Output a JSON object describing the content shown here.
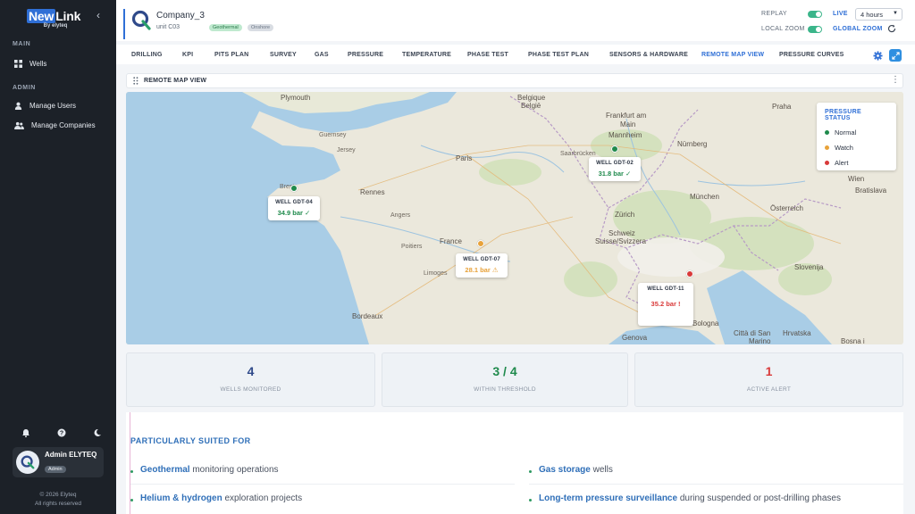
{
  "app": {
    "logo": {
      "new": "New",
      "link": "Link",
      "sub": "By elyteq"
    },
    "sidebar": {
      "main_section": "MAIN",
      "admin_section": "ADMIN",
      "items": [
        {
          "label": "Wells",
          "icon": "grid-icon"
        },
        {
          "label": "Manage Users",
          "icon": "user-icon"
        },
        {
          "label": "Manage Companies",
          "icon": "users-icon"
        }
      ],
      "bottom_icons": [
        "bell-icon",
        "help-icon",
        "moon-icon"
      ],
      "user": {
        "name": "Admin ELYTEQ",
        "role": "Admin"
      },
      "copyright": "© 2026 Elyteq",
      "rights": "All rights reserved"
    }
  },
  "header": {
    "company_name": "Company_3",
    "unit": "unit C03",
    "tags": [
      "Geothermal",
      "Onshore"
    ],
    "replay_label": "REPLAY",
    "live_label": "LIVE",
    "local_zoom_label": "LOCAL ZOOM",
    "global_zoom_label": "GLOBAL ZOOM",
    "time_range": "4 hours",
    "accent_color": "#2f6fd6"
  },
  "tabs": [
    "DRILLING",
    "KPI",
    "PITS PLAN",
    "SURVEY",
    "GAS",
    "PRESSURE",
    "TEMPERATURE",
    "PHASE TEST",
    "PHASE TEST PLAN",
    "SENSORS & HARDWARE",
    "REMOTE MAP VIEW",
    "PRESSURE CURVES"
  ],
  "active_tab": "REMOTE MAP VIEW",
  "panel": {
    "title": "REMOTE MAP VIEW"
  },
  "map": {
    "labels": {
      "plymouth": "Plymouth",
      "belgique": "Belgique",
      "belgie": "België",
      "frankfurt": "Frankfurt am",
      "main": "Main",
      "praha": "Praha",
      "guernsey": "Guernsey",
      "jersey": "Jersey",
      "mannheim": "Mannheim",
      "nurnberg": "Nürnberg",
      "paris": "Paris",
      "saarbrucken": "Saarbrücken",
      "wien": "Wien",
      "bratislava": "Bratislava",
      "brest": "Brest",
      "rennes": "Rennes",
      "munchen": "München",
      "osterreich": "Österreich",
      "angers": "Angers",
      "zurich": "Zürich",
      "france": "France",
      "schweiz": "Schweiz",
      "suisse": "Suisse/Svizzera",
      "poitiers": "Poitiers",
      "limoges": "Limoges",
      "slovenija": "Slovenija",
      "bordeaux": "Bordeaux",
      "bologna": "Bologna",
      "genova": "Genova",
      "citta": "Città di San",
      "marino": "Marino",
      "hrvatska": "Hrvatska",
      "bosna": "Bosna i"
    },
    "wells": [
      {
        "name": "WELL GDT-04",
        "value": "34.9 bar ✓",
        "status": "normal"
      },
      {
        "name": "WELL GDT-02",
        "value": "31.8 bar ✓",
        "status": "normal"
      },
      {
        "name": "WELL GDT-07",
        "value": "28.1 bar ⚠",
        "status": "watch"
      },
      {
        "name": "WELL GDT-11",
        "value": "35.2 bar !",
        "status": "alert"
      }
    ],
    "legend": {
      "title": "PRESSURE STATUS",
      "items": [
        {
          "label": "Normal",
          "color": "#1f8a4c"
        },
        {
          "label": "Watch",
          "color": "#e8a23a"
        },
        {
          "label": "Alert",
          "color": "#d93a3a"
        }
      ]
    },
    "status_colors": {
      "normal": "#1f8a4c",
      "watch": "#e8a23a",
      "alert": "#d93a3a"
    }
  },
  "stats": [
    {
      "value": "4",
      "label": "WELLS MONITORED",
      "color": "#2f4a8a"
    },
    {
      "value": "3 / 4",
      "label": "WITHIN THRESHOLD",
      "color": "#1f8a4c"
    },
    {
      "value": "1",
      "label": "ACTIVE ALERT",
      "color": "#d93a3a"
    }
  ],
  "suited": {
    "title": "PARTICULARLY SUITED FOR",
    "items": [
      {
        "highlight": "Geothermal",
        "rest": " monitoring operations"
      },
      {
        "highlight": "Gas storage",
        "rest": " wells"
      },
      {
        "highlight": "Helium & hydrogen",
        "rest": " exploration projects"
      },
      {
        "highlight": "Long-term pressure surveillance",
        "rest": " during suspended or post-drilling phases"
      }
    ]
  }
}
